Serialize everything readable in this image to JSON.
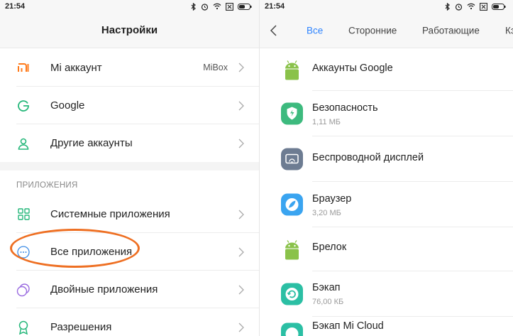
{
  "status": {
    "time": "21:54"
  },
  "settings": {
    "title": "Настройки",
    "accounts": [
      {
        "label": "Mi аккаунт",
        "value": "MiBox",
        "icon": "mi-logo-icon"
      },
      {
        "label": "Google",
        "value": "",
        "icon": "google-g-icon"
      },
      {
        "label": "Другие аккаунты",
        "value": "",
        "icon": "person-icon"
      }
    ],
    "apps_section_title": "ПРИЛОЖЕНИЯ",
    "apps": [
      {
        "label": "Системные приложения",
        "icon": "grid-icon"
      },
      {
        "label": "Все приложения",
        "icon": "more-dots-icon"
      },
      {
        "label": "Двойные приложения",
        "icon": "dual-circles-icon"
      },
      {
        "label": "Разрешения",
        "icon": "badge-icon"
      }
    ]
  },
  "apps_list": {
    "tabs": [
      "Все",
      "Сторонние",
      "Работающие",
      "Кэш"
    ],
    "active_tab": "Все",
    "items": [
      {
        "name": "Аккаунты Google",
        "size": "",
        "icon": "android-icon"
      },
      {
        "name": "Безопасность",
        "size": "1,11 МБ",
        "icon": "shield-icon"
      },
      {
        "name": "Беспроводной дисплей",
        "size": "",
        "icon": "cast-icon"
      },
      {
        "name": "Браузер",
        "size": "3,20 МБ",
        "icon": "browser-icon"
      },
      {
        "name": "Брелок",
        "size": "",
        "icon": "android-icon"
      },
      {
        "name": "Бэкап",
        "size": "76,00 КБ",
        "icon": "backup-icon"
      },
      {
        "name": "Бэкап Mi Cloud",
        "size": "",
        "icon": "backup-icon"
      }
    ]
  },
  "colors": {
    "accent": "#2f84ff",
    "highlight": "#ee6f22",
    "mi_orange": "#ff7a1a",
    "android_green": "#8ac24a"
  }
}
